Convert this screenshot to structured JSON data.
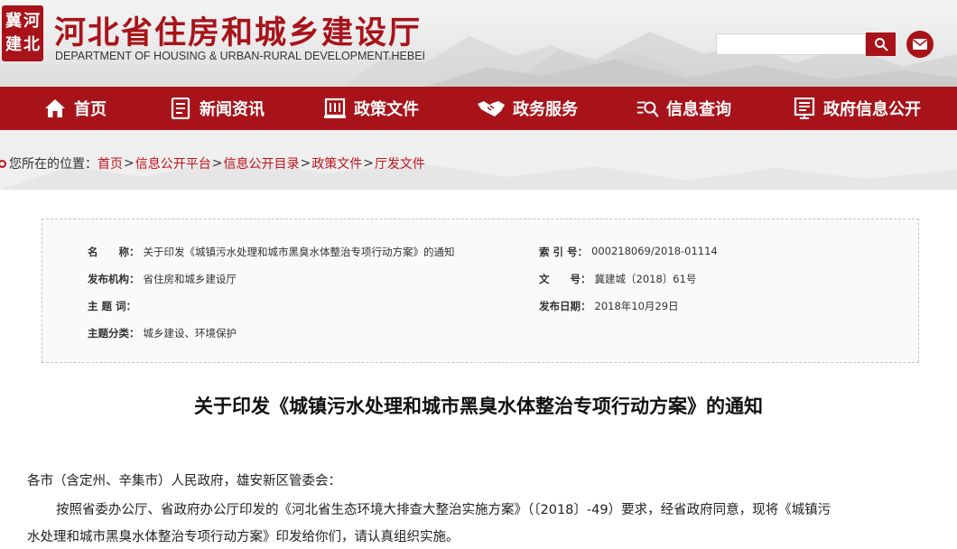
{
  "header": {
    "seal_chars": [
      "冀",
      "河",
      "建",
      "北"
    ],
    "title": "河北省住房和城乡建设厅",
    "subtitle": "DEPARTMENT OF HOUSING & URBAN-RURAL DEVELOPMENT.HEBEI",
    "search_placeholder": "",
    "search_icon": "search-icon",
    "mail_icon": "mail-icon"
  },
  "nav": {
    "items": [
      {
        "label": "首页",
        "icon": "home-icon"
      },
      {
        "label": "新闻资讯",
        "icon": "news-icon"
      },
      {
        "label": "政策文件",
        "icon": "policy-icon"
      },
      {
        "label": "政务服务",
        "icon": "handshake-icon"
      },
      {
        "label": "信息查询",
        "icon": "query-icon"
      },
      {
        "label": "政府信息公开",
        "icon": "disclosure-icon"
      }
    ]
  },
  "breadcrumb": {
    "prefix": "您所在的位置：",
    "items": [
      "首页",
      "信息公开平台",
      "信息公开目录",
      "政策文件",
      "厅发文件"
    ],
    "separator": ">"
  },
  "info": {
    "name_key": "名　　称：",
    "name_val": "关于印发《城镇污水处理和城市黑臭水体整治专项行动方案》的通知",
    "index_key": "索 引 号：",
    "index_val": "000218069/2018-01114",
    "org_key": "发布机构：",
    "org_val": "省住房和城乡建设厅",
    "docno_key": "文　　号：",
    "docno_val": "冀建城〔2018〕61号",
    "subject_key": "主 题 词：",
    "subject_val": "",
    "date_key": "发布日期：",
    "date_val": "2018年10月29日",
    "category_key": "主题分类：",
    "category_val": "城乡建设、环境保护"
  },
  "article": {
    "title": "关于印发《城镇污水处理和城市黑臭水体整治专项行动方案》的通知",
    "salutation": "各市（含定州、辛集市）人民政府，雄安新区管委会：",
    "body_line1": "按照省委办公厅、省政府办公厅印发的《河北省生态环境大排查大整治实施方案》（〔2018〕-49）要求，经省政府同意，现将《城镇污",
    "body_line2": "水处理和城市黑臭水体整治专项行动方案》印发给你们，请认真组织实施。"
  },
  "colors": {
    "brand_red": "#a8131a",
    "link_red": "#c1121a"
  }
}
